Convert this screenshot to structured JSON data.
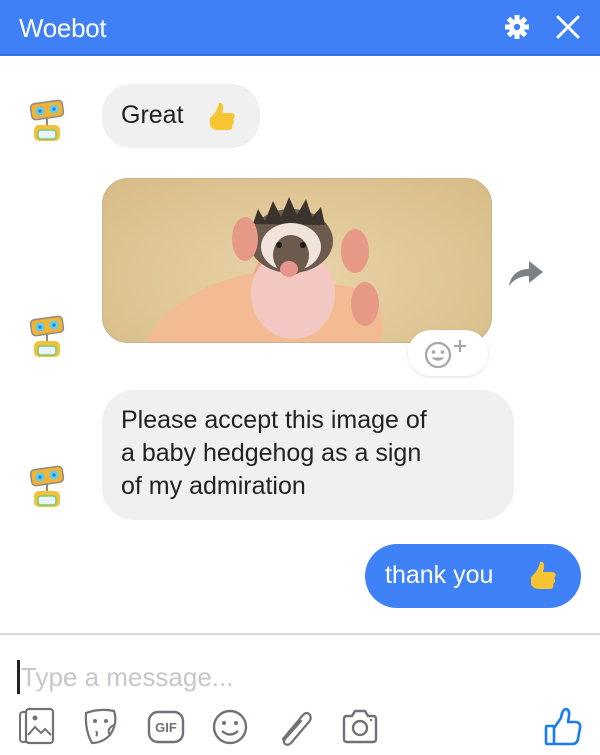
{
  "header": {
    "title": "Woebot",
    "settings_icon": "gear-icon",
    "close_icon": "close-icon",
    "color": "#4080f6"
  },
  "messages": [
    {
      "sender": "bot",
      "type": "text",
      "text": "Great",
      "emoji": "thumbs-up"
    },
    {
      "sender": "bot",
      "type": "image",
      "image_description": "baby hedgehog held in a hand",
      "actions": [
        "share-icon",
        "add-reaction-icon"
      ]
    },
    {
      "sender": "bot",
      "type": "text",
      "lines": [
        "Please accept this image of",
        "a baby hedgehog as a sign",
        "of my admiration"
      ]
    },
    {
      "sender": "user",
      "type": "text",
      "text": "thank you",
      "emoji": "thumbs-up"
    }
  ],
  "composer": {
    "placeholder": "Type a message...",
    "value": "",
    "tools": [
      "photo-icon",
      "sticker-icon",
      "gif-icon",
      "emoji-icon",
      "attachment-icon",
      "camera-icon"
    ],
    "gif_label": "GIF",
    "send_like_icon": "thumbs-up-icon",
    "like_color": "#1a7cf5"
  },
  "colors": {
    "bot_bubble": "#f0f0f0",
    "user_bubble": "#3f82f7",
    "emoji_yellow": "#f7c531"
  }
}
